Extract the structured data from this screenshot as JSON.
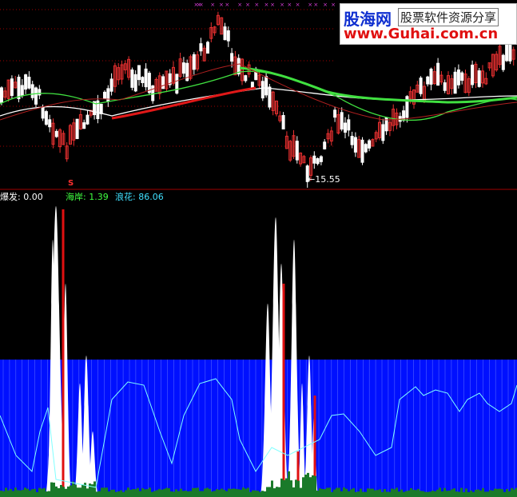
{
  "colors": {
    "background": "#000000",
    "separator": "#a00000",
    "blue_fill": "#0010ff",
    "white": "#ffffff",
    "green_bars": "#1a7a2a",
    "red_bars": "#e01010",
    "cyan_line": "#7fffff",
    "ma_green": "#40e040",
    "ma_white": "#ffffff",
    "ma_red": "#e01818",
    "candle_up": "#e83030",
    "candle_down": "#ffffff",
    "dotted_grid": "#a00000",
    "label_white": "#ffffff",
    "label_green": "#40ff40",
    "label_cyan": "#40e0ff",
    "label_red": "#ff3030"
  },
  "price_panel": {
    "low_marker_text": "←15.55",
    "signal_marker": "S"
  },
  "indicator_panel": {
    "labels": [
      {
        "name": "爆发",
        "text": "爆发: 0.00"
      },
      {
        "name": "海岸",
        "text": "海岸: 1.39"
      },
      {
        "name": "浪花",
        "text": "浪花: 86.06"
      }
    ]
  },
  "watermark": {
    "brand": "股海网",
    "slogan": "股票软件资源分享",
    "url": "www.Guhai.com.cn"
  }
}
